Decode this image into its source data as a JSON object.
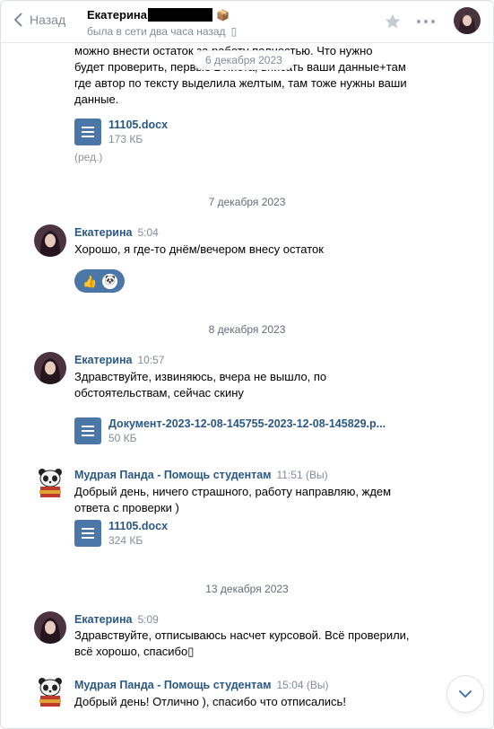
{
  "header": {
    "back_label": "Назад",
    "peer_name": "Екатерина",
    "peer_emoji": "📦",
    "status": "была в сети два часа назад",
    "phone_glyph": "▯"
  },
  "floating_date": "6 декабря 2023",
  "messages": {
    "m0": {
      "lines": [
        "можно внести остаток за работу полностью. Что нужно",
        "будет проверить, первые 2 листа, вписать ваши данные+там",
        "где автор по тексту выделила желтым, там тоже нужны ваши",
        "данные."
      ],
      "doc_name": "11105.docx",
      "doc_size": "173 КБ",
      "edited": "(ред.)"
    },
    "d1": "7 декабря 2023",
    "m1": {
      "author": "Екатерина",
      "time": "5:04",
      "text": "Хорошо, я где-то днём/вечером внесу остаток",
      "reactions": [
        "👍",
        "🐼"
      ]
    },
    "d2": "8 декабря 2023",
    "m2": {
      "author": "Екатерина",
      "time": "10:57",
      "lines": [
        "Здравствуйте, извиняюсь, вчера не вышло, по",
        "обстоятельствам, сейчас скину"
      ],
      "doc_name": "Документ-2023-12-08-145755-2023-12-08-145829.p...",
      "doc_size": "50 КБ"
    },
    "m3": {
      "author": "Мудрая Панда - Помощь студентам",
      "time": "11:51 (Вы)",
      "lines": [
        "Добрый день, ничего страшного, работу направляю, ждем",
        "ответа с проверки )"
      ],
      "doc_name": "11105.docx",
      "doc_size": "324 КБ"
    },
    "d3": "13 декабря 2023",
    "m4": {
      "author": "Екатерина",
      "time": "5:09",
      "lines": [
        "Здравствуйте, отписываюсь насчет курсовой. Всё проверили,",
        "всё хорошо, спасибо▯"
      ]
    },
    "m5": {
      "author": "Мудрая Панда - Помощь студентам",
      "time": "15:04 (Вы)",
      "text": "Добрый день! Отлично ), спасибо что отписались!"
    }
  },
  "colors": {
    "link": "#2a5885",
    "accent": "#4a76a8",
    "muted": "#818c99"
  }
}
